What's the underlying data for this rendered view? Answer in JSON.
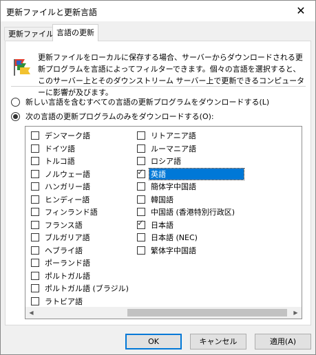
{
  "window": {
    "title": "更新ファイルと更新言語",
    "close_glyph": "✕"
  },
  "tabs": [
    {
      "label": "更新ファイル"
    },
    {
      "label": "言語の更新"
    }
  ],
  "description": "更新ファイルをローカルに保存する場合、サーバーからダウンロードされる更新プログラムを言語によってフィルターできます。個々の言語を選択すると、このサーバー上とそのダウンストリーム サーバー上で更新できるコンピューターに影響が及びます。",
  "options": {
    "all_languages": {
      "label": "新しい言語を含むすべての言語の更新プログラムをダウンロードする(L)",
      "selected": false
    },
    "only_languages": {
      "label": "次の言語の更新プログラムのみをダウンロードする(O):",
      "selected": true
    }
  },
  "languages_col1": [
    {
      "label": "デンマーク語",
      "checked": false
    },
    {
      "label": "ドイツ語",
      "checked": false
    },
    {
      "label": "トルコ語",
      "checked": false
    },
    {
      "label": "ノルウェー語",
      "checked": false
    },
    {
      "label": "ハンガリー語",
      "checked": false
    },
    {
      "label": "ヒンディー語",
      "checked": false
    },
    {
      "label": "フィンランド語",
      "checked": false
    },
    {
      "label": "フランス語",
      "checked": false
    },
    {
      "label": "ブルガリア語",
      "checked": false
    },
    {
      "label": "ヘブライ語",
      "checked": false
    },
    {
      "label": "ポーランド語",
      "checked": false
    },
    {
      "label": "ポルトガル語",
      "checked": false
    },
    {
      "label": "ポルトガル語 (ブラジル)",
      "checked": false
    },
    {
      "label": "ラトビア語",
      "checked": false
    }
  ],
  "languages_col2": [
    {
      "label": "リトアニア語",
      "checked": false,
      "selected": false
    },
    {
      "label": "ルーマニア語",
      "checked": false,
      "selected": false
    },
    {
      "label": "ロシア語",
      "checked": false,
      "selected": false
    },
    {
      "label": "英語",
      "checked": true,
      "selected": true
    },
    {
      "label": "簡体字中国語",
      "checked": false,
      "selected": false
    },
    {
      "label": "韓国語",
      "checked": false,
      "selected": false
    },
    {
      "label": "中国語 (香港特別行政区)",
      "checked": false,
      "selected": false
    },
    {
      "label": "日本語",
      "checked": true,
      "selected": false
    },
    {
      "label": "日本語 (NEC)",
      "checked": false,
      "selected": false
    },
    {
      "label": "繁体字中国語",
      "checked": false,
      "selected": false
    }
  ],
  "buttons": {
    "ok": "OK",
    "cancel": "キャンセル",
    "apply": "適用(A)"
  },
  "colors": {
    "selection": "#0078d7",
    "default_button_border": "#0078d7"
  },
  "icons": {
    "intro": "language-update-icon",
    "check": "check-icon"
  }
}
